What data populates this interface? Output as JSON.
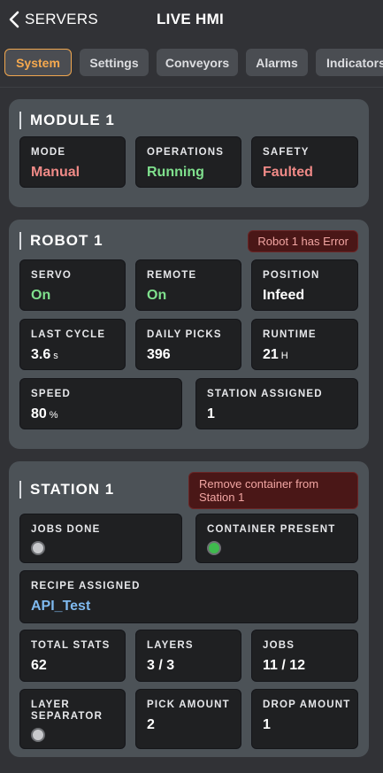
{
  "header": {
    "back_label": "SERVERS",
    "title": "LIVE HMI"
  },
  "tabs": [
    {
      "label": "System",
      "active": true
    },
    {
      "label": "Settings",
      "active": false
    },
    {
      "label": "Conveyors",
      "active": false
    },
    {
      "label": "Alarms",
      "active": false
    },
    {
      "label": "Indicators",
      "active": false
    }
  ],
  "colors": {
    "accent": "#f6a94e",
    "value_red": "#f08a87",
    "value_green": "#7fe08d",
    "value_blue": "#7fbaf0",
    "indicator_on": "#3fba4e",
    "indicator_off": "#c8c9cc"
  },
  "module": {
    "title": "MODULE 1",
    "mode": {
      "label": "MODE",
      "value": "Manual"
    },
    "operations": {
      "label": "OPERATIONS",
      "value": "Running"
    },
    "safety": {
      "label": "SAFETY",
      "value": "Faulted"
    }
  },
  "robot": {
    "title": "ROBOT 1",
    "error": "Robot 1 has Error",
    "servo": {
      "label": "SERVO",
      "value": "On"
    },
    "remote": {
      "label": "REMOTE",
      "value": "On"
    },
    "position": {
      "label": "POSITION",
      "value": "Infeed"
    },
    "last_cycle": {
      "label": "LAST CYCLE",
      "value": "3.6",
      "unit": "s"
    },
    "daily_picks": {
      "label": "DAILY PICKS",
      "value": "396"
    },
    "runtime": {
      "label": "RUNTIME",
      "value": "21",
      "unit": "H"
    },
    "speed": {
      "label": "SPEED",
      "value": "80",
      "unit": "%"
    },
    "station_assigned": {
      "label": "STATION ASSIGNED",
      "value": "1"
    }
  },
  "station": {
    "title": "STATION 1",
    "alert_line1": "Remove container from",
    "alert_line2": "Station 1",
    "jobs_done": {
      "label": "JOBS DONE",
      "state": "off"
    },
    "container_present": {
      "label": "CONTAINER PRESENT",
      "state": "on"
    },
    "recipe": {
      "label": "RECIPE ASSIGNED",
      "value": "API_Test"
    },
    "total_stats": {
      "label": "TOTAL STATS",
      "value": "62"
    },
    "layers": {
      "label": "LAYERS",
      "value": "3 / 3"
    },
    "jobs": {
      "label": "JOBS",
      "value": "11 / 12"
    },
    "layer_separator": {
      "label_line1": "LAYER",
      "label_line2": "SEPARATOR",
      "state": "off"
    },
    "pick_amount": {
      "label": "PICK AMOUNT",
      "value": "2"
    },
    "drop_amount": {
      "label": "DROP AMOUNT",
      "value": "1"
    }
  }
}
